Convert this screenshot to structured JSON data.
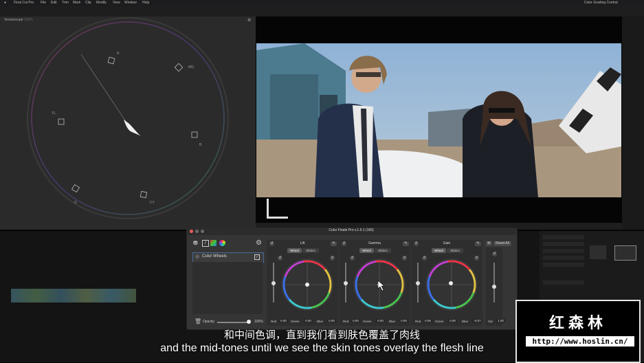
{
  "menubar": {
    "apple_icon": "apple-icon",
    "items": [
      "Final Cut Pro",
      "File",
      "Edit",
      "Trim",
      "Mark",
      "Clip",
      "Modify",
      "View",
      "Window",
      "Help"
    ],
    "right_text": "Color Grading Central"
  },
  "scope": {
    "title": "Vectorscope",
    "title_suffix": "100%",
    "targets": [
      "R",
      "MG",
      "B",
      "CY",
      "G",
      "YL"
    ]
  },
  "plugin": {
    "title": "Color Finale Pro v.1.6.1 (169)",
    "layer_label": "Color Wheels",
    "opacity_label": "Opacity",
    "opacity_value": "100%",
    "m_button": "M",
    "reset_all": "Reset All",
    "mode_wheel": "Wheel",
    "mode_sliders": "Sliders",
    "sat_label": "Sat",
    "sat_value": "1.00",
    "wheels": [
      {
        "title": "Lift",
        "red": "0.00",
        "green": "0.00",
        "blue": "0.00"
      },
      {
        "title": "Gamma",
        "red": "0.00",
        "green": "0.00",
        "blue": "0.00"
      },
      {
        "title": "Gain",
        "red": "0.06",
        "green": "0.00",
        "blue": "-0.07"
      }
    ],
    "red_label": "Red",
    "green_label": "Green",
    "blue_label": "Blue"
  },
  "subtitles": {
    "chinese": "和中间色调，直到我们看到肤色覆盖了肉线",
    "english": "and the mid-tones until we see the skin tones overlay the flesh line"
  },
  "watermark": {
    "name": "红森林",
    "url": "http://www.hoslin.cn/"
  },
  "colors": {
    "accent": "#4a6a9a",
    "wheel_red": "#e8364a",
    "wheel_green": "#49c24e",
    "wheel_blue": "#3b6fe8"
  }
}
